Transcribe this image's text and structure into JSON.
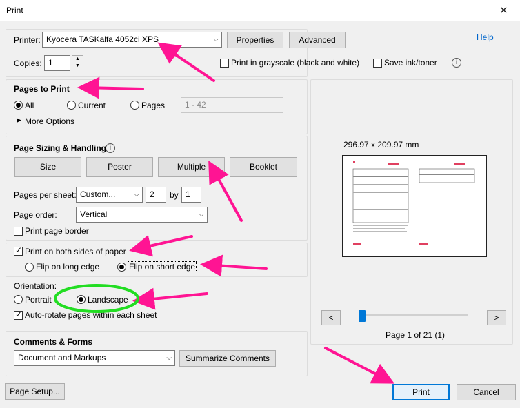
{
  "window": {
    "title": "Print",
    "close_glyph": "✕"
  },
  "help": {
    "label": "Help"
  },
  "printer": {
    "label": "Printer:",
    "selected": "Kyocera TASKalfa 4052ci XPS",
    "properties_label": "Properties",
    "advanced_label": "Advanced"
  },
  "copies": {
    "label": "Copies:",
    "value": "1"
  },
  "print_options": {
    "grayscale_label": "Print in grayscale (black and white)",
    "save_ink_label": "Save ink/toner"
  },
  "pages_to_print": {
    "heading": "Pages to Print",
    "all_label": "All",
    "current_label": "Current",
    "pages_label": "Pages",
    "pages_range": "1 - 42",
    "more_options_label": "More Options"
  },
  "page_sizing": {
    "heading": "Page Sizing & Handling",
    "size_label": "Size",
    "poster_label": "Poster",
    "multiple_label": "Multiple",
    "booklet_label": "Booklet",
    "pages_per_sheet_label": "Pages per sheet:",
    "pages_per_sheet_value": "Custom...",
    "grid_cols": "2",
    "by_label": "by",
    "grid_rows": "1",
    "page_order_label": "Page order:",
    "page_order_value": "Vertical",
    "border_label": "Print page border"
  },
  "duplex": {
    "both_sides_label": "Print on both sides of paper",
    "long_edge_label": "Flip on long edge",
    "short_edge_label": "Flip on short edge"
  },
  "orientation": {
    "heading": "Orientation:",
    "portrait_label": "Portrait",
    "landscape_label": "Landscape",
    "autorotate_label": "Auto-rotate pages within each sheet"
  },
  "comments": {
    "heading": "Comments & Forms",
    "selected": "Document and Markups",
    "summarize_label": "Summarize Comments"
  },
  "preview": {
    "dimensions": "296.97 x 209.97 mm",
    "page_indicator": "Page 1 of 21 (1)",
    "prev_glyph": "<",
    "next_glyph": ">",
    "slider_position": 0
  },
  "footer": {
    "page_setup_label": "Page Setup...",
    "print_label": "Print",
    "cancel_label": "Cancel"
  },
  "annotation_colors": {
    "arrow": "#ff1493",
    "circle": "#22dd22"
  }
}
